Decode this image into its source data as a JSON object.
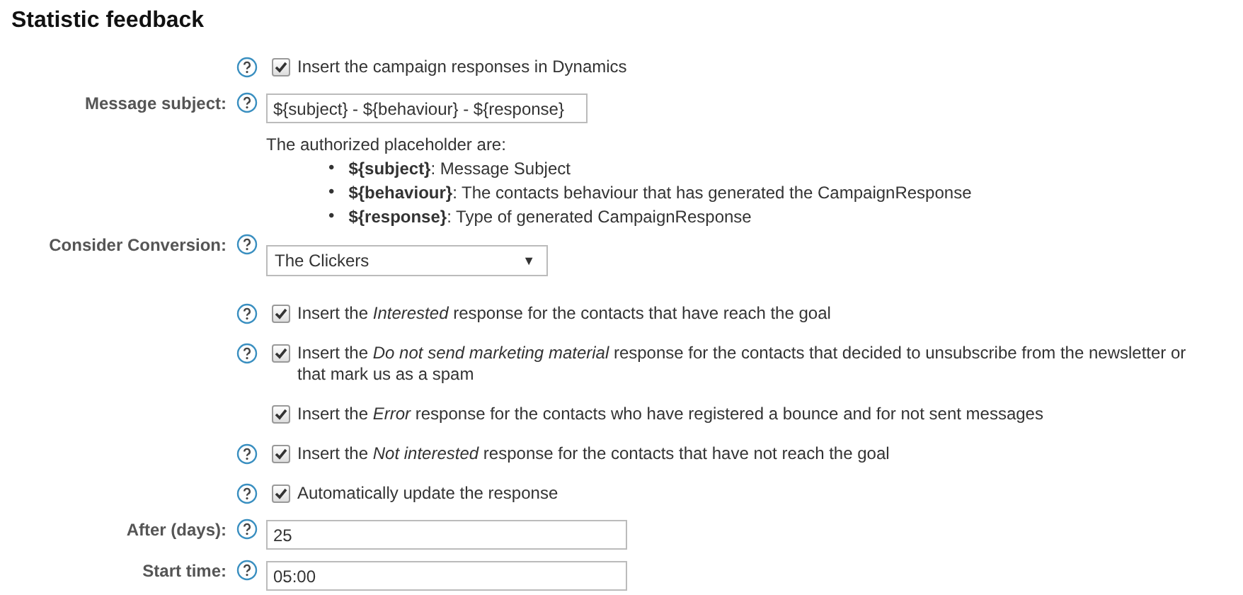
{
  "title": "Statistic feedback",
  "rows": [
    {
      "kind": "checkbox",
      "help": true,
      "checked": true,
      "text": "Insert the campaign responses in Dynamics"
    },
    {
      "kind": "input",
      "label": "Message subject:",
      "help": true,
      "wide": false,
      "value": "${subject} - ${behaviour} - ${response}",
      "note": "The authorized placeholder are:",
      "items": [
        {
          "bullet": "•",
          "text": "**${subject}**: Message Subject"
        },
        {
          "bullet": "•",
          "text": "**${behaviour}**: The contacts behaviour that has generated the CampaignResponse"
        },
        {
          "bullet": "•",
          "text": "**${response}**: Type of generated CampaignResponse"
        }
      ]
    },
    {
      "kind": "select",
      "label": "Consider Conversion:",
      "help": true,
      "value": "The Clickers",
      "arrow": "▼"
    },
    {
      "kind": "checkbox",
      "help": true,
      "checked": true,
      "text": "Insert the *Interested* response for the contacts that have reach the goal"
    },
    {
      "kind": "checkbox",
      "help": true,
      "checked": true,
      "text": "Insert the *Do not send marketing material* response for the contacts that decided to unsubscribe from the newsletter or that mark us as a spam"
    },
    {
      "kind": "checkbox",
      "help": false,
      "checked": true,
      "text": "Insert the *Error* response for the contacts who have registered a bounce and for not sent messages"
    },
    {
      "kind": "checkbox",
      "help": true,
      "checked": true,
      "text": "Insert the *Not interested* response for the contacts that have not reach the goal"
    },
    {
      "kind": "checkbox",
      "help": true,
      "checked": true,
      "text": "Automatically update the response"
    },
    {
      "kind": "input",
      "label": "After (days):",
      "help": true,
      "value": "25",
      "wide": true
    },
    {
      "kind": "input",
      "label": "Start time:",
      "help": true,
      "value": "05:00",
      "wide": true
    }
  ]
}
